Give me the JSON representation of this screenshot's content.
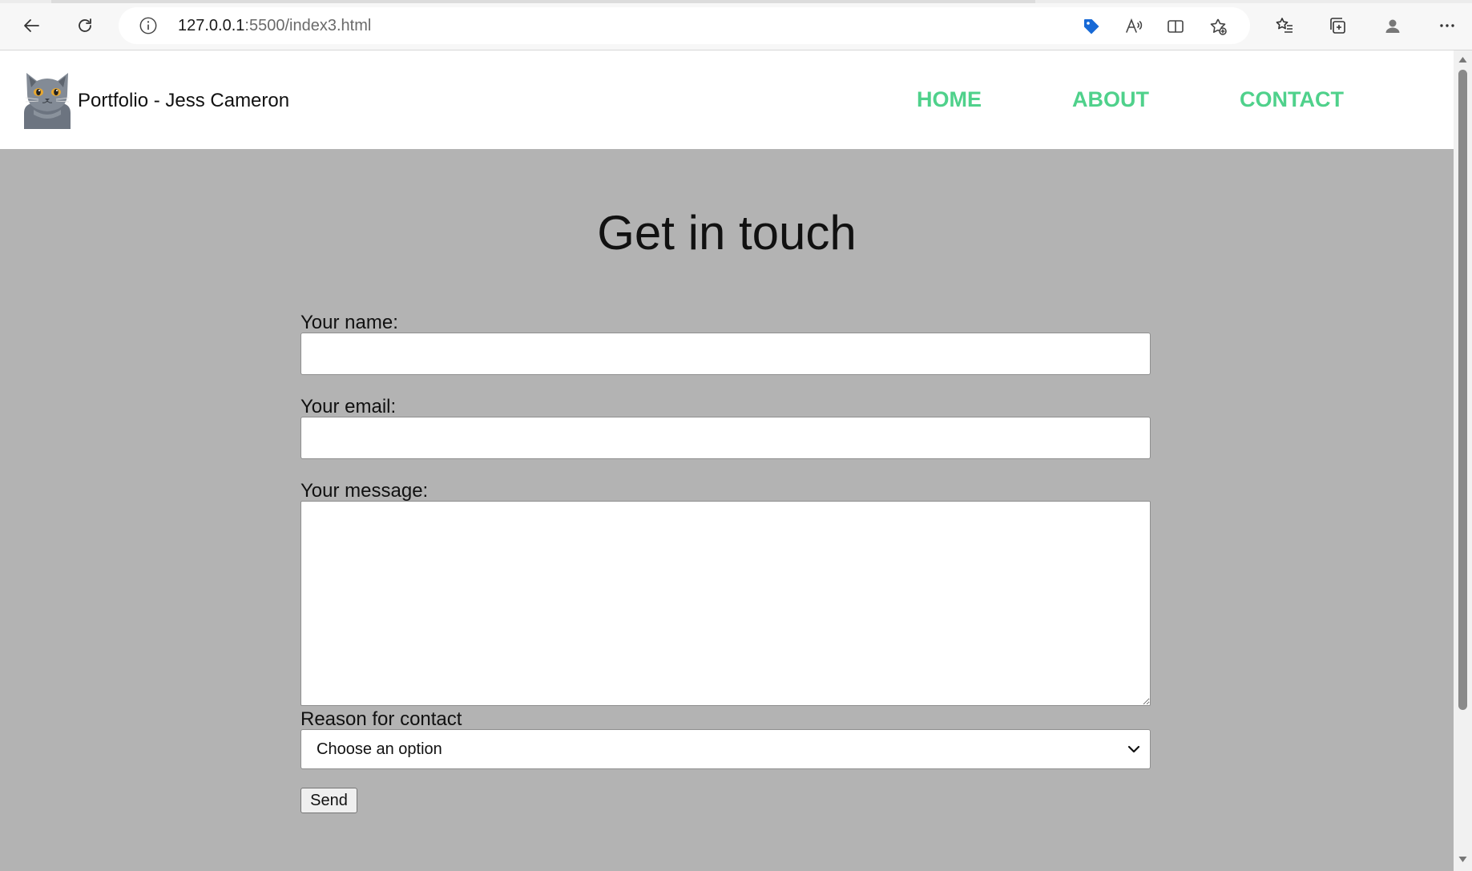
{
  "browser": {
    "url_host": "127.0.0.1",
    "url_rest": ":5500/index3.html"
  },
  "site": {
    "title": "Portfolio - Jess Cameron",
    "nav": [
      {
        "label": "HOME"
      },
      {
        "label": "ABOUT"
      },
      {
        "label": "CONTACT"
      }
    ],
    "accent_color": "#4fd18b"
  },
  "form": {
    "heading": "Get in touch",
    "name_label": "Your name:",
    "name_value": "",
    "email_label": "Your email:",
    "email_value": "",
    "message_label": "Your message:",
    "message_value": "",
    "reason_label": "Reason for contact",
    "reason_selected": "Choose an option",
    "send_label": "Send"
  }
}
